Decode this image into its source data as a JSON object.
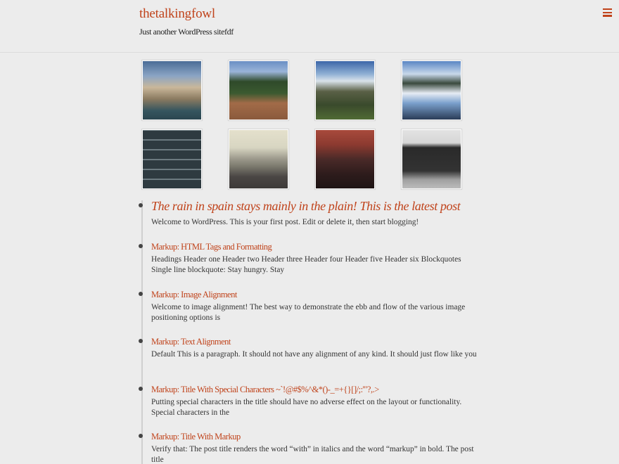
{
  "site": {
    "title": "thetalkingfowl",
    "description": "Just another WordPress sitefdf"
  },
  "menu": {
    "icon": "hamburger-menu-icon"
  },
  "gallery": [
    {
      "name": "mountain-lake-photo",
      "colors": [
        "#4a6c96",
        "#c9b79a",
        "#35555f"
      ]
    },
    {
      "name": "forest-rock-photo",
      "colors": [
        "#6a8fc4",
        "#2f4a2a",
        "#a26b48"
      ]
    },
    {
      "name": "mountain-valley-photo",
      "colors": [
        "#8fb0d4",
        "#5a6046",
        "#3a4a2c"
      ]
    },
    {
      "name": "snowy-river-photo",
      "colors": [
        "#7aa0cc",
        "#e6ecf4",
        "#2a3c58"
      ]
    },
    {
      "name": "buffalo-block-bricks-photo",
      "colors": [
        "#2e3a40",
        "#6c7a80",
        "#1d2528"
      ]
    },
    {
      "name": "misty-lake-photo",
      "colors": [
        "#d8d6c2",
        "#7c7a6e",
        "#3d3a38"
      ]
    },
    {
      "name": "restaurant-group-photo",
      "colors": [
        "#8c3a30",
        "#4a2a28",
        "#1e1414"
      ]
    },
    {
      "name": "smoker-grill-photo",
      "colors": [
        "#d6d6d6",
        "#2a2a2a",
        "#a0a0a0"
      ]
    }
  ],
  "posts": [
    {
      "title": "The rain in spain stays mainly in the plain! This is the latest post",
      "excerpt": "Welcome to WordPress. This is your first post. Edit or delete it, then start blogging!"
    },
    {
      "title": "Markup: HTML Tags and Formatting",
      "excerpt": "Headings Header one Header two Header three Header four Header five Header six Blockquotes Single line blockquote: Stay hungry. Stay"
    },
    {
      "title": "Markup: Image Alignment",
      "excerpt": "Welcome to image alignment! The best way to demonstrate the ebb and flow of the various image positioning options is"
    },
    {
      "title": "Markup: Text Alignment",
      "excerpt": "Default This is a paragraph. It should not have any alignment of any kind. It should just flow like you"
    },
    {
      "title": "Markup: Title With Special Characters ~`!@#$%^&*()-_=+{}[]/;:'\"?,.>",
      "excerpt": "Putting special characters in the title should have no adverse effect on the layout or functionality. Special characters in the"
    },
    {
      "title": "Markup: Title With Markup",
      "excerpt": "Verify that: The post title renders the word “with” in italics and the word “markup” in bold. The post title"
    }
  ],
  "colors": {
    "accent": "#c0431b",
    "background": "#ececec"
  }
}
